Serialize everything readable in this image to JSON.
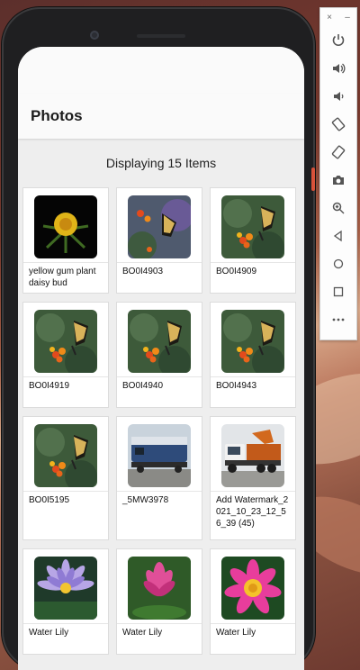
{
  "app": {
    "title": "Photos"
  },
  "summary": {
    "text": "Displaying 15 Items"
  },
  "photos": [
    {
      "caption": "yellow gum plant daisy bud",
      "kind": "gum"
    },
    {
      "caption": "BO0I4903",
      "kind": "butterfly-purple"
    },
    {
      "caption": "BO0I4909",
      "kind": "butterfly"
    },
    {
      "caption": "BO0I4919",
      "kind": "butterfly"
    },
    {
      "caption": "BO0I4940",
      "kind": "butterfly"
    },
    {
      "caption": "BO0I4943",
      "kind": "butterfly"
    },
    {
      "caption": "BO0I5195",
      "kind": "butterfly"
    },
    {
      "caption": "_5MW3978",
      "kind": "train"
    },
    {
      "caption": "Add Watermark_2021_10_23_12_56_39 (45)",
      "kind": "truck"
    },
    {
      "caption": "Water Lily",
      "kind": "lily-purple"
    },
    {
      "caption": "Water Lily",
      "kind": "lily-pink"
    },
    {
      "caption": "Water Lily",
      "kind": "lily-magenta"
    }
  ],
  "emulator": {
    "window_controls": [
      "×",
      "–"
    ],
    "buttons": [
      "power-icon",
      "volume-up-icon",
      "volume-down-icon",
      "rotate-left-icon",
      "rotate-right-icon",
      "camera-icon",
      "zoom-icon",
      "back-icon",
      "home-icon",
      "overview-icon",
      "more-icon"
    ]
  },
  "colors": {
    "accent": "#d8523a",
    "app_bar": "#fafafa",
    "content_bg": "#eeeeee"
  }
}
